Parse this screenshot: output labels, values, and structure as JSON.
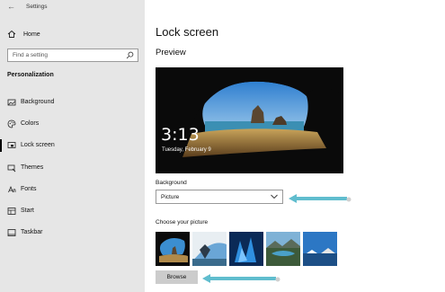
{
  "window": {
    "title": "Settings"
  },
  "sidebar": {
    "home_label": "Home",
    "search_placeholder": "Find a setting",
    "section_title": "Personalization",
    "items": [
      {
        "label": "Background",
        "icon": "picture-icon"
      },
      {
        "label": "Colors",
        "icon": "palette-icon"
      },
      {
        "label": "Lock screen",
        "icon": "lock-screen-icon",
        "active": true
      },
      {
        "label": "Themes",
        "icon": "brush-icon"
      },
      {
        "label": "Fonts",
        "icon": "font-icon"
      },
      {
        "label": "Start",
        "icon": "start-icon"
      },
      {
        "label": "Taskbar",
        "icon": "taskbar-icon"
      }
    ]
  },
  "main": {
    "title": "Lock screen",
    "preview_label": "Preview",
    "preview": {
      "time": "3:13",
      "date": "Tuesday, February 9"
    },
    "background_label": "Background",
    "background_value": "Picture",
    "choose_label": "Choose your picture",
    "browse_label": "Browse"
  },
  "colors": {
    "sidebar_bg": "#e6e6e6",
    "annotation_arrow": "#4fb6c9",
    "active_indicator": "#000000"
  }
}
